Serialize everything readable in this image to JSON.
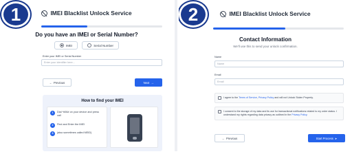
{
  "service_title": "IMEI Blacklist Unlock Service",
  "panel1": {
    "badge": "1",
    "progress": 0.38,
    "question": "Do you have an IMEI or Serial Number?",
    "options": [
      {
        "label": "IMEI",
        "selected": true
      },
      {
        "label": "Serial Number",
        "selected": false
      }
    ],
    "input_label": "Enter your IMEI or Serial Number",
    "input_placeholder": "Enter your identifier here...",
    "prev_label": "Previous",
    "next_label": "Next",
    "help_title": "How to find your IMEI",
    "help_steps": [
      {
        "num": "1",
        "text": "Dial *#06# on your device and press call"
      },
      {
        "num": "2",
        "text": "Find and Enter the IMEI"
      },
      {
        "num": "3",
        "text": "(also sometimes called MEID)"
      }
    ]
  },
  "panel2": {
    "badge": "2",
    "progress": 0.55,
    "title": "Contact Information",
    "subtitle": "We'll use this to send your unlock confirmation.",
    "name_label": "Name",
    "name_placeholder": "Name",
    "email_label": "Email",
    "email_placeholder": "Email",
    "agree_before": "I agree to the ",
    "agree_terms": "Terms of Service",
    "agree_sep": ", ",
    "agree_privacy": "Privacy Policy",
    "agree_after": " and will not Unlock Stolen Property.",
    "consent_text": "I consent to the storage of my data and its use for transactional notifications related to my order status. I understand my rights regarding data privacy as outlined in the ",
    "consent_link": "Privacy Policy",
    "consent_end": ".",
    "prev_label": "Previous",
    "submit_label": "Start Process"
  },
  "colors": {
    "accent": "#2563eb",
    "badge": "#1a3a8f"
  }
}
